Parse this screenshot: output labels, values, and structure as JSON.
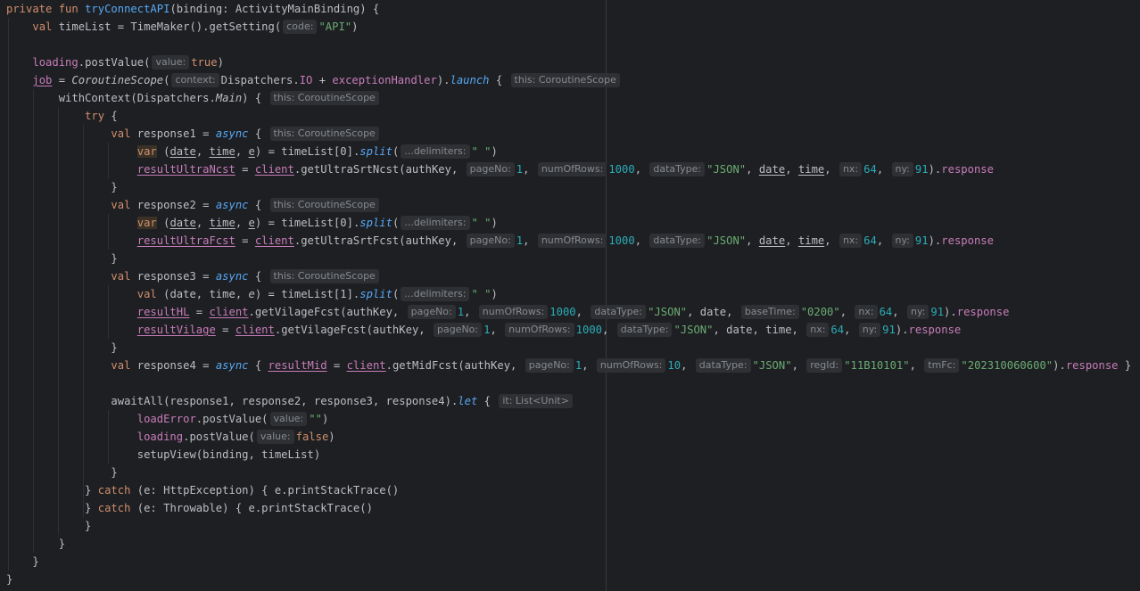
{
  "editor": {
    "colors": {
      "background": "#1e1f22",
      "keyword": "#cf8e6d",
      "function": "#56a8f5",
      "number": "#2aacb8",
      "string": "#6aab73",
      "property": "#c77dbb",
      "hint_background": "#2e3033",
      "hint_text": "#868a91"
    },
    "lines": [
      [
        {
          "c": "kw",
          "t": "private fun "
        },
        {
          "c": "fn",
          "t": "tryConnectAPI"
        },
        {
          "c": "id",
          "t": "(binding: ActivityMainBinding) {"
        }
      ],
      [
        {
          "c": "id",
          "t": "    "
        },
        {
          "c": "kw",
          "t": "val "
        },
        {
          "c": "id",
          "t": "timeList = TimeMaker().getSetting("
        },
        {
          "c": "hint",
          "t": "code:"
        },
        {
          "c": "str",
          "t": "\"API\""
        },
        {
          "c": "id",
          "t": ")"
        }
      ],
      [],
      [
        {
          "c": "id",
          "t": "    "
        },
        {
          "c": "prop",
          "t": "loading"
        },
        {
          "c": "id",
          "t": ".postValue("
        },
        {
          "c": "hint",
          "t": "value:"
        },
        {
          "c": "kw",
          "t": "true"
        },
        {
          "c": "id",
          "t": ")"
        }
      ],
      [
        {
          "c": "id",
          "t": "    "
        },
        {
          "c": "var",
          "t": "job"
        },
        {
          "c": "id",
          "t": " = "
        },
        {
          "c": "it",
          "t": "CoroutineScope"
        },
        {
          "c": "id",
          "t": "("
        },
        {
          "c": "hint",
          "t": "context:"
        },
        {
          "c": "id",
          "t": "Dispatchers."
        },
        {
          "c": "prop",
          "t": "IO"
        },
        {
          "c": "id",
          "t": " + "
        },
        {
          "c": "prop",
          "t": "exceptionHandler"
        },
        {
          "c": "id",
          "t": ")."
        },
        {
          "c": "ext",
          "t": "launch"
        },
        {
          "c": "id",
          "t": " { "
        },
        {
          "c": "hint",
          "t": "this: CoroutineScope"
        }
      ],
      [
        {
          "c": "id",
          "t": "        withContext(Dispatchers."
        },
        {
          "c": "it",
          "t": "Main"
        },
        {
          "c": "id",
          "t": ") { "
        },
        {
          "c": "hint",
          "t": "this: CoroutineScope"
        }
      ],
      [
        {
          "c": "id",
          "t": "            "
        },
        {
          "c": "kw",
          "t": "try"
        },
        {
          "c": "id",
          "t": " {"
        }
      ],
      [
        {
          "c": "id",
          "t": "                "
        },
        {
          "c": "kw",
          "t": "val "
        },
        {
          "c": "id",
          "t": "response1 = "
        },
        {
          "c": "ext",
          "t": "async"
        },
        {
          "c": "id",
          "t": " { "
        },
        {
          "c": "hint",
          "t": "this: CoroutineScope"
        }
      ],
      [
        {
          "c": "id",
          "t": "                    "
        },
        {
          "c": "varkw",
          "t": "var"
        },
        {
          "c": "id",
          "t": " ("
        },
        {
          "c": "ul",
          "t": "date"
        },
        {
          "c": "id",
          "t": ", "
        },
        {
          "c": "ul",
          "t": "time"
        },
        {
          "c": "id",
          "t": ", "
        },
        {
          "c": "ul",
          "t": "e"
        },
        {
          "c": "id",
          "t": ") = timeList[0]."
        },
        {
          "c": "ext",
          "t": "split"
        },
        {
          "c": "id",
          "t": "("
        },
        {
          "c": "hint",
          "t": "...delimiters:"
        },
        {
          "c": "str",
          "t": "\" \""
        },
        {
          "c": "id",
          "t": ")"
        }
      ],
      [
        {
          "c": "id",
          "t": "                    "
        },
        {
          "c": "var",
          "t": "resultUltraNcst"
        },
        {
          "c": "id",
          "t": " = "
        },
        {
          "c": "var",
          "t": "client"
        },
        {
          "c": "id",
          "t": ".getUltraSrtNcst(authKey, "
        },
        {
          "c": "hint",
          "t": "pageNo:"
        },
        {
          "c": "num",
          "t": "1"
        },
        {
          "c": "id",
          "t": ", "
        },
        {
          "c": "hint",
          "t": "numOfRows:"
        },
        {
          "c": "num",
          "t": "1000"
        },
        {
          "c": "id",
          "t": ", "
        },
        {
          "c": "hint",
          "t": "dataType:"
        },
        {
          "c": "str",
          "t": "\"JSON\""
        },
        {
          "c": "id",
          "t": ", "
        },
        {
          "c": "ul",
          "t": "date"
        },
        {
          "c": "id",
          "t": ", "
        },
        {
          "c": "ul",
          "t": "time"
        },
        {
          "c": "id",
          "t": ", "
        },
        {
          "c": "hint",
          "t": "nx:"
        },
        {
          "c": "num",
          "t": "64"
        },
        {
          "c": "id",
          "t": ", "
        },
        {
          "c": "hint",
          "t": "ny:"
        },
        {
          "c": "num",
          "t": "91"
        },
        {
          "c": "id",
          "t": ")."
        },
        {
          "c": "prop",
          "t": "response"
        }
      ],
      [
        {
          "c": "id",
          "t": "                }"
        }
      ],
      [
        {
          "c": "id",
          "t": "                "
        },
        {
          "c": "kw",
          "t": "val "
        },
        {
          "c": "id",
          "t": "response2 = "
        },
        {
          "c": "ext",
          "t": "async"
        },
        {
          "c": "id",
          "t": " { "
        },
        {
          "c": "hint",
          "t": "this: CoroutineScope"
        }
      ],
      [
        {
          "c": "id",
          "t": "                    "
        },
        {
          "c": "varkw",
          "t": "var"
        },
        {
          "c": "id",
          "t": " ("
        },
        {
          "c": "ul",
          "t": "date"
        },
        {
          "c": "id",
          "t": ", "
        },
        {
          "c": "ul",
          "t": "time"
        },
        {
          "c": "id",
          "t": ", "
        },
        {
          "c": "ul",
          "t": "e"
        },
        {
          "c": "id",
          "t": ") = timeList[0]."
        },
        {
          "c": "ext",
          "t": "split"
        },
        {
          "c": "id",
          "t": "("
        },
        {
          "c": "hint",
          "t": "...delimiters:"
        },
        {
          "c": "str",
          "t": "\" \""
        },
        {
          "c": "id",
          "t": ")"
        }
      ],
      [
        {
          "c": "id",
          "t": "                    "
        },
        {
          "c": "var",
          "t": "resultUltraFcst"
        },
        {
          "c": "id",
          "t": " = "
        },
        {
          "c": "var",
          "t": "client"
        },
        {
          "c": "id",
          "t": ".getUltraSrtFcst(authKey, "
        },
        {
          "c": "hint",
          "t": "pageNo:"
        },
        {
          "c": "num",
          "t": "1"
        },
        {
          "c": "id",
          "t": ", "
        },
        {
          "c": "hint",
          "t": "numOfRows:"
        },
        {
          "c": "num",
          "t": "1000"
        },
        {
          "c": "id",
          "t": ", "
        },
        {
          "c": "hint",
          "t": "dataType:"
        },
        {
          "c": "str",
          "t": "\"JSON\""
        },
        {
          "c": "id",
          "t": ", "
        },
        {
          "c": "ul",
          "t": "date"
        },
        {
          "c": "id",
          "t": ", "
        },
        {
          "c": "ul",
          "t": "time"
        },
        {
          "c": "id",
          "t": ", "
        },
        {
          "c": "hint",
          "t": "nx:"
        },
        {
          "c": "num",
          "t": "64"
        },
        {
          "c": "id",
          "t": ", "
        },
        {
          "c": "hint",
          "t": "ny:"
        },
        {
          "c": "num",
          "t": "91"
        },
        {
          "c": "id",
          "t": ")."
        },
        {
          "c": "prop",
          "t": "response"
        }
      ],
      [
        {
          "c": "id",
          "t": "                }"
        }
      ],
      [
        {
          "c": "id",
          "t": "                "
        },
        {
          "c": "kw",
          "t": "val "
        },
        {
          "c": "id",
          "t": "response3 = "
        },
        {
          "c": "ext",
          "t": "async"
        },
        {
          "c": "id",
          "t": " { "
        },
        {
          "c": "hint",
          "t": "this: CoroutineScope"
        }
      ],
      [
        {
          "c": "id",
          "t": "                    "
        },
        {
          "c": "kw",
          "t": "val"
        },
        {
          "c": "id",
          "t": " (date, time, "
        },
        {
          "c": "it",
          "t": "e"
        },
        {
          "c": "id",
          "t": ") = timeList[1]."
        },
        {
          "c": "ext",
          "t": "split"
        },
        {
          "c": "id",
          "t": "("
        },
        {
          "c": "hint",
          "t": "...delimiters:"
        },
        {
          "c": "str",
          "t": "\" \""
        },
        {
          "c": "id",
          "t": ")"
        }
      ],
      [
        {
          "c": "id",
          "t": "                    "
        },
        {
          "c": "var",
          "t": "resultHL"
        },
        {
          "c": "id",
          "t": " = "
        },
        {
          "c": "var",
          "t": "client"
        },
        {
          "c": "id",
          "t": ".getVilageFcst(authKey, "
        },
        {
          "c": "hint",
          "t": "pageNo:"
        },
        {
          "c": "num",
          "t": "1"
        },
        {
          "c": "id",
          "t": ", "
        },
        {
          "c": "hint",
          "t": "numOfRows:"
        },
        {
          "c": "num",
          "t": "1000"
        },
        {
          "c": "id",
          "t": ", "
        },
        {
          "c": "hint",
          "t": "dataType:"
        },
        {
          "c": "str",
          "t": "\"JSON\""
        },
        {
          "c": "id",
          "t": ", date, "
        },
        {
          "c": "hint",
          "t": "baseTime:"
        },
        {
          "c": "str",
          "t": "\"0200\""
        },
        {
          "c": "id",
          "t": ", "
        },
        {
          "c": "hint",
          "t": "nx:"
        },
        {
          "c": "num",
          "t": "64"
        },
        {
          "c": "id",
          "t": ", "
        },
        {
          "c": "hint",
          "t": "ny:"
        },
        {
          "c": "num",
          "t": "91"
        },
        {
          "c": "id",
          "t": ")."
        },
        {
          "c": "prop",
          "t": "response"
        }
      ],
      [
        {
          "c": "id",
          "t": "                    "
        },
        {
          "c": "var",
          "t": "resultVilage"
        },
        {
          "c": "id",
          "t": " = "
        },
        {
          "c": "var",
          "t": "client"
        },
        {
          "c": "id",
          "t": ".getVilageFcst(authKey, "
        },
        {
          "c": "hint",
          "t": "pageNo:"
        },
        {
          "c": "num",
          "t": "1"
        },
        {
          "c": "id",
          "t": ", "
        },
        {
          "c": "hint",
          "t": "numOfRows:"
        },
        {
          "c": "num",
          "t": "1000"
        },
        {
          "c": "id",
          "t": ", "
        },
        {
          "c": "hint",
          "t": "dataType:"
        },
        {
          "c": "str",
          "t": "\"JSON\""
        },
        {
          "c": "id",
          "t": ", date, time, "
        },
        {
          "c": "hint",
          "t": "nx:"
        },
        {
          "c": "num",
          "t": "64"
        },
        {
          "c": "id",
          "t": ", "
        },
        {
          "c": "hint",
          "t": "ny:"
        },
        {
          "c": "num",
          "t": "91"
        },
        {
          "c": "id",
          "t": ")."
        },
        {
          "c": "prop",
          "t": "response"
        }
      ],
      [
        {
          "c": "id",
          "t": "                }"
        }
      ],
      [
        {
          "c": "id",
          "t": "                "
        },
        {
          "c": "kw",
          "t": "val "
        },
        {
          "c": "id",
          "t": "response4 = "
        },
        {
          "c": "ext",
          "t": "async"
        },
        {
          "c": "id",
          "t": " { "
        },
        {
          "c": "var",
          "t": "resultMid"
        },
        {
          "c": "id",
          "t": " = "
        },
        {
          "c": "var",
          "t": "client"
        },
        {
          "c": "id",
          "t": ".getMidFcst(authKey, "
        },
        {
          "c": "hint",
          "t": "pageNo:"
        },
        {
          "c": "num",
          "t": "1"
        },
        {
          "c": "id",
          "t": ", "
        },
        {
          "c": "hint",
          "t": "numOfRows:"
        },
        {
          "c": "num",
          "t": "10"
        },
        {
          "c": "id",
          "t": ", "
        },
        {
          "c": "hint",
          "t": "dataType:"
        },
        {
          "c": "str",
          "t": "\"JSON\""
        },
        {
          "c": "id",
          "t": ", "
        },
        {
          "c": "hint",
          "t": "regId:"
        },
        {
          "c": "str",
          "t": "\"11B10101\""
        },
        {
          "c": "id",
          "t": ", "
        },
        {
          "c": "hint",
          "t": "tmFc:"
        },
        {
          "c": "str",
          "t": "\"202310060600\""
        },
        {
          "c": "id",
          "t": ")."
        },
        {
          "c": "prop",
          "t": "response"
        },
        {
          "c": "id",
          "t": " }"
        }
      ],
      [],
      [
        {
          "c": "id",
          "t": "                awaitAll(response1, response2, response3, response4)."
        },
        {
          "c": "ext",
          "t": "let"
        },
        {
          "c": "id",
          "t": " { "
        },
        {
          "c": "hint",
          "t": "it: List<Unit>"
        }
      ],
      [
        {
          "c": "id",
          "t": "                    "
        },
        {
          "c": "prop",
          "t": "loadError"
        },
        {
          "c": "id",
          "t": ".postValue("
        },
        {
          "c": "hint",
          "t": "value:"
        },
        {
          "c": "str",
          "t": "\"\""
        },
        {
          "c": "id",
          "t": ")"
        }
      ],
      [
        {
          "c": "id",
          "t": "                    "
        },
        {
          "c": "prop",
          "t": "loading"
        },
        {
          "c": "id",
          "t": ".postValue("
        },
        {
          "c": "hint",
          "t": "value:"
        },
        {
          "c": "kw",
          "t": "false"
        },
        {
          "c": "id",
          "t": ")"
        }
      ],
      [
        {
          "c": "id",
          "t": "                    setupView(binding, timeList)"
        }
      ],
      [
        {
          "c": "id",
          "t": "                }"
        }
      ],
      [
        {
          "c": "id",
          "t": "            } "
        },
        {
          "c": "kw",
          "t": "catch"
        },
        {
          "c": "id",
          "t": " (e: HttpException) { e.printStackTrace()"
        }
      ],
      [
        {
          "c": "id",
          "t": "            } "
        },
        {
          "c": "kw",
          "t": "catch"
        },
        {
          "c": "id",
          "t": " (e: Throwable) { e.printStackTrace()"
        }
      ],
      [
        {
          "c": "id",
          "t": "            }"
        }
      ],
      [
        {
          "c": "id",
          "t": "        }"
        }
      ],
      [
        {
          "c": "id",
          "t": "    }"
        }
      ],
      [
        {
          "c": "id",
          "t": "}"
        }
      ]
    ]
  }
}
